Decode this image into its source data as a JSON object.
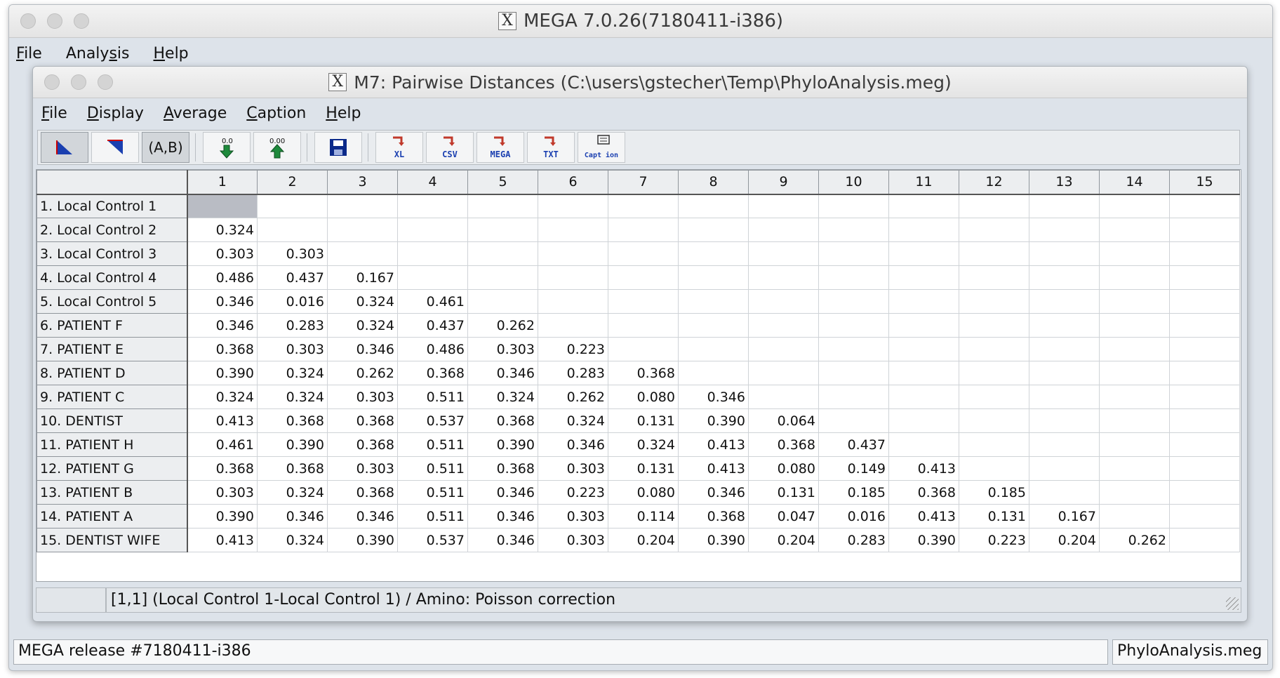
{
  "outer": {
    "title": "MEGA 7.0.26(7180411-i386)",
    "menu": [
      "File",
      "Analysis",
      "Help"
    ],
    "status_left": "MEGA release #7180411-i386",
    "status_right": "PhyloAnalysis.meg"
  },
  "inner": {
    "title": "M7: Pairwise Distances (C:\\users\\gstecher\\Temp\\PhyloAnalysis.meg)",
    "menu": [
      "File",
      "Display",
      "Average",
      "Caption",
      "Help"
    ],
    "toolbar": {
      "ab_label": "(A,B)",
      "decrease_label": "0.0",
      "increase_label": "0.00",
      "xl_label": "XL",
      "csv_label": "CSV",
      "mega_label": "MEGA",
      "txt_label": "TXT",
      "caption_label": "Capt ion"
    },
    "status_text": "[1,1] (Local Control 1-Local Control 1) / Amino: Poisson correction"
  },
  "table": {
    "columns": [
      "1",
      "2",
      "3",
      "4",
      "5",
      "6",
      "7",
      "8",
      "9",
      "10",
      "11",
      "12",
      "13",
      "14",
      "15"
    ],
    "rows": [
      {
        "label": "1. Local Control 1",
        "values": []
      },
      {
        "label": "2. Local Control 2",
        "values": [
          "0.324"
        ]
      },
      {
        "label": "3. Local Control 3",
        "values": [
          "0.303",
          "0.303"
        ]
      },
      {
        "label": "4. Local Control 4",
        "values": [
          "0.486",
          "0.437",
          "0.167"
        ]
      },
      {
        "label": "5. Local Control 5",
        "values": [
          "0.346",
          "0.016",
          "0.324",
          "0.461"
        ]
      },
      {
        "label": "6. PATIENT F",
        "values": [
          "0.346",
          "0.283",
          "0.324",
          "0.437",
          "0.262"
        ]
      },
      {
        "label": "7. PATIENT E",
        "values": [
          "0.368",
          "0.303",
          "0.346",
          "0.486",
          "0.303",
          "0.223"
        ]
      },
      {
        "label": "8. PATIENT D",
        "values": [
          "0.390",
          "0.324",
          "0.262",
          "0.368",
          "0.346",
          "0.283",
          "0.368"
        ]
      },
      {
        "label": "9. PATIENT C",
        "values": [
          "0.324",
          "0.324",
          "0.303",
          "0.511",
          "0.324",
          "0.262",
          "0.080",
          "0.346"
        ]
      },
      {
        "label": "10. DENTIST",
        "values": [
          "0.413",
          "0.368",
          "0.368",
          "0.537",
          "0.368",
          "0.324",
          "0.131",
          "0.390",
          "0.064"
        ]
      },
      {
        "label": "11. PATIENT H",
        "values": [
          "0.461",
          "0.390",
          "0.368",
          "0.511",
          "0.390",
          "0.346",
          "0.324",
          "0.413",
          "0.368",
          "0.437"
        ]
      },
      {
        "label": "12. PATIENT G",
        "values": [
          "0.368",
          "0.368",
          "0.303",
          "0.511",
          "0.368",
          "0.303",
          "0.131",
          "0.413",
          "0.080",
          "0.149",
          "0.413"
        ]
      },
      {
        "label": "13. PATIENT B",
        "values": [
          "0.303",
          "0.324",
          "0.368",
          "0.511",
          "0.346",
          "0.223",
          "0.080",
          "0.346",
          "0.131",
          "0.185",
          "0.368",
          "0.185"
        ]
      },
      {
        "label": "14. PATIENT A",
        "values": [
          "0.390",
          "0.346",
          "0.346",
          "0.511",
          "0.346",
          "0.303",
          "0.114",
          "0.368",
          "0.047",
          "0.016",
          "0.413",
          "0.131",
          "0.167"
        ]
      },
      {
        "label": "15. DENTIST WIFE",
        "values": [
          "0.413",
          "0.324",
          "0.390",
          "0.537",
          "0.346",
          "0.303",
          "0.204",
          "0.390",
          "0.204",
          "0.283",
          "0.390",
          "0.223",
          "0.204",
          "0.262"
        ]
      }
    ],
    "selected_cell": "[1,1]"
  }
}
